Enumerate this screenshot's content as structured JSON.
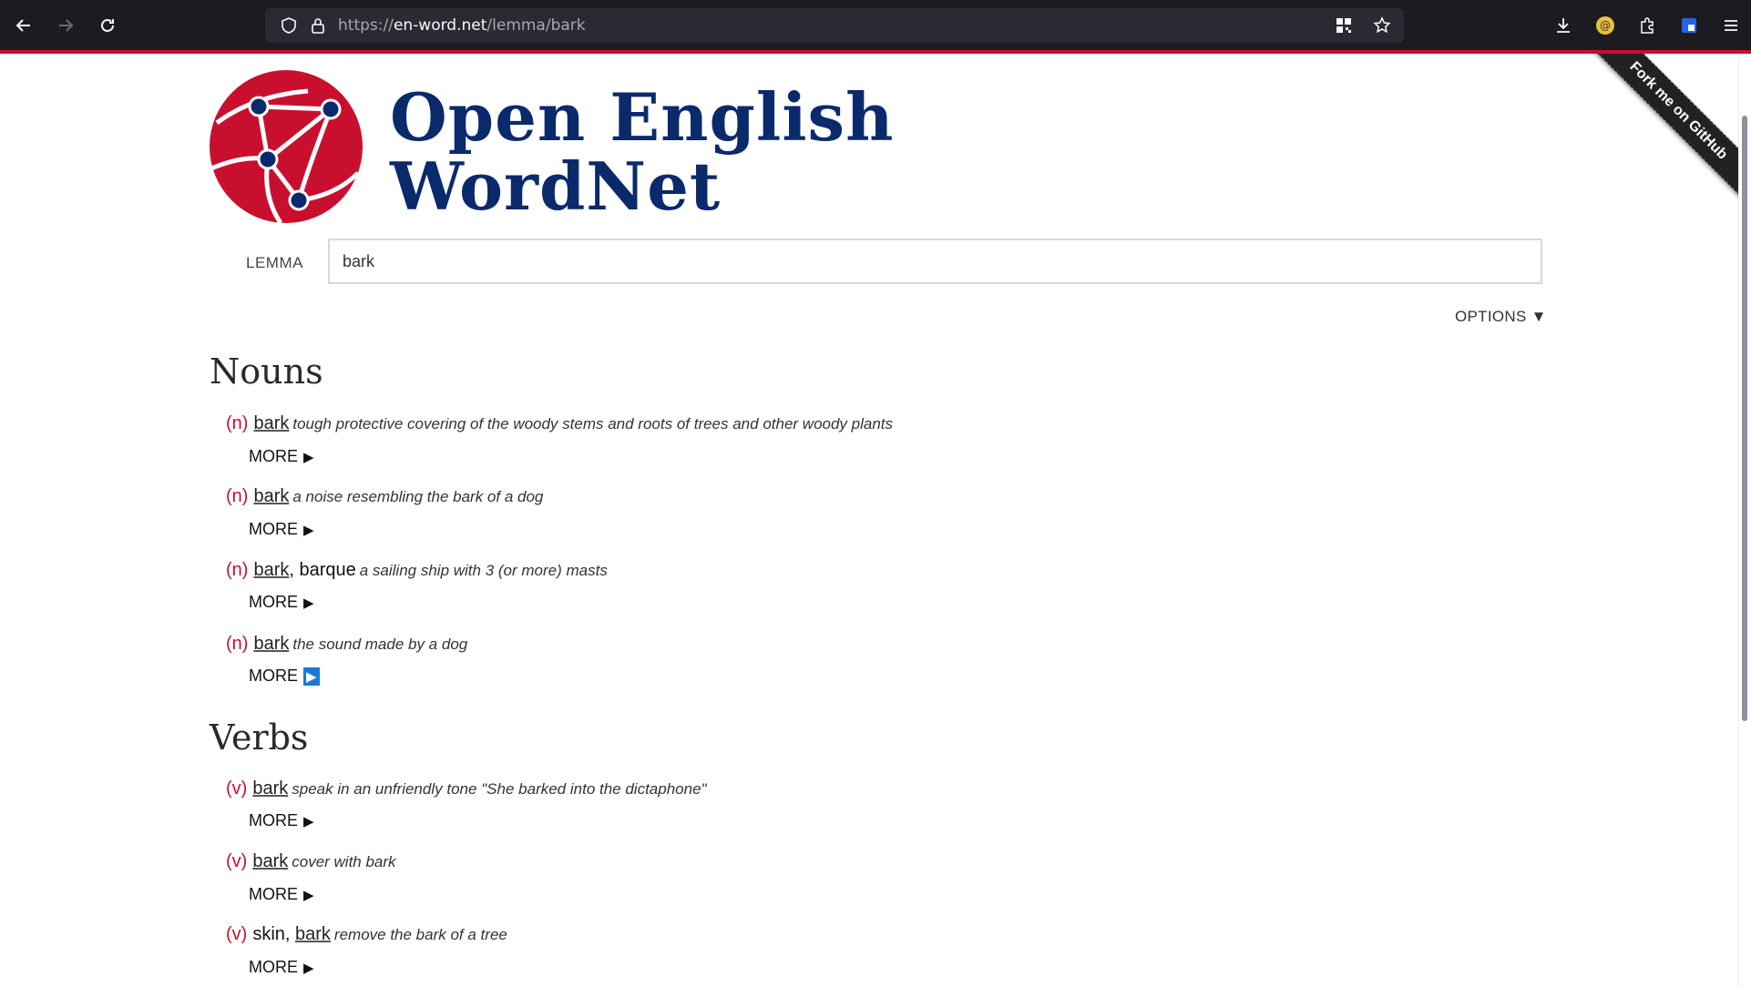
{
  "browser": {
    "url_prefix": "https://",
    "url_host": "en-word.net",
    "url_path": "/lemma/bark"
  },
  "ribbon": {
    "label": "Fork me on GitHub"
  },
  "header": {
    "title_line1": "Open English",
    "title_line2": "WordNet"
  },
  "search": {
    "label": "LEMMA",
    "value": "bark",
    "options_label": "OPTIONS ▼"
  },
  "nouns": {
    "title": "Nouns",
    "entries": [
      {
        "pos": "(n)",
        "lemma": "bark",
        "extra": "",
        "gloss": "tough protective covering of the woody stems and roots of trees and other woody plants",
        "more": "MORE"
      },
      {
        "pos": "(n)",
        "lemma": "bark",
        "extra": "",
        "gloss": "a noise resembling the bark of a dog",
        "more": "MORE"
      },
      {
        "pos": "(n)",
        "lemma": "bark",
        "extra": ", barque",
        "gloss": "a sailing ship with 3 (or more) masts",
        "more": "MORE"
      },
      {
        "pos": "(n)",
        "lemma": "bark",
        "extra": "",
        "gloss": "the sound made by a dog",
        "more": "MORE"
      }
    ]
  },
  "verbs": {
    "title": "Verbs",
    "entries": [
      {
        "pos": "(v)",
        "lemma": "bark",
        "gloss": "speak in an unfriendly tone \"She barked into the dictaphone\"",
        "more": "MORE"
      },
      {
        "pos": "(v)",
        "lemma": "bark",
        "gloss": "cover with bark",
        "more": "MORE"
      },
      {
        "pos": "(v)",
        "prefix": "skin, ",
        "lemma": "bark",
        "gloss": "remove the bark of a tree",
        "more": "MORE"
      }
    ]
  },
  "colors": {
    "accent": "#c8102e",
    "brand_blue": "#0b2a6b",
    "focus": "#1a7ad8"
  }
}
